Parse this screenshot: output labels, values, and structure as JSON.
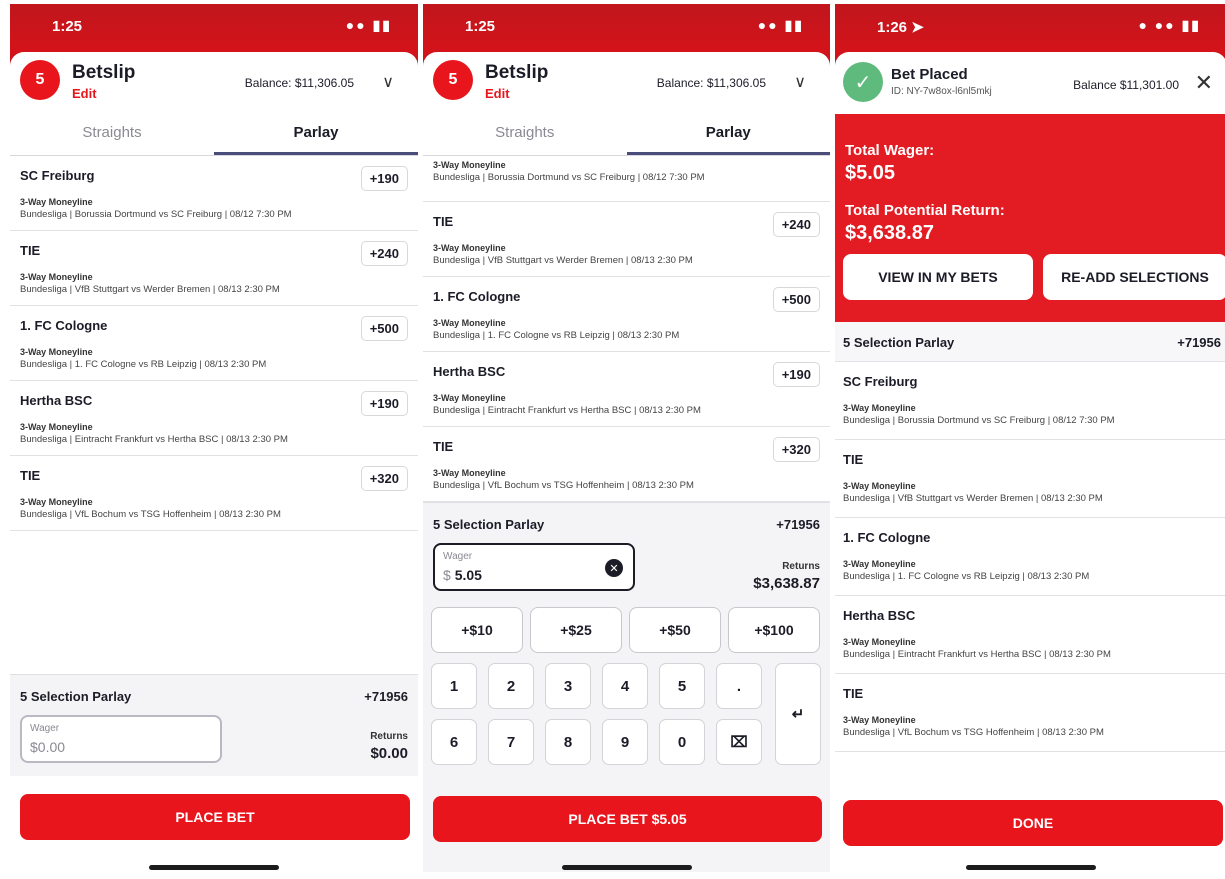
{
  "phone1": {
    "status_time": "1:25",
    "badge_count": "5",
    "title": "Betslip",
    "edit_label": "Edit",
    "balance": "Balance: $11,306.05",
    "tabs": [
      "Straights",
      "Parlay"
    ],
    "legs": [
      {
        "team": "SC Freiburg",
        "odds": "+190",
        "market": "3-Way Moneyline",
        "game": "Bundesliga | Borussia Dortmund vs SC Freiburg | 08/12 7:30 PM"
      },
      {
        "team": "TIE",
        "odds": "+240",
        "market": "3-Way Moneyline",
        "game": "Bundesliga | VfB Stuttgart vs Werder Bremen | 08/13 2:30 PM"
      },
      {
        "team": "1. FC Cologne",
        "odds": "+500",
        "market": "3-Way Moneyline",
        "game": "Bundesliga | 1. FC Cologne vs RB Leipzig | 08/13 2:30 PM"
      },
      {
        "team": "Hertha BSC",
        "odds": "+190",
        "market": "3-Way Moneyline",
        "game": "Bundesliga | Eintracht Frankfurt vs Hertha BSC | 08/13 2:30 PM"
      },
      {
        "team": "TIE",
        "odds": "+320",
        "market": "3-Way Moneyline",
        "game": "Bundesliga | VfL Bochum vs TSG Hoffenheim | 08/13 2:30 PM"
      }
    ],
    "parlay_label": "5 Selection Parlay",
    "parlay_odds": "+71956",
    "wager_label": "Wager",
    "wager_value": "$0.00",
    "returns_label": "Returns",
    "returns_value": "$0.00",
    "place_bet_label": "PLACE BET"
  },
  "phone2": {
    "status_time": "1:25",
    "badge_count": "5",
    "title": "Betslip",
    "edit_label": "Edit",
    "balance": "Balance: $11,306.05",
    "tabs": [
      "Straights",
      "Parlay"
    ],
    "top_partial": {
      "market": "3-Way Moneyline",
      "game": "Bundesliga | Borussia Dortmund vs SC Freiburg | 08/12 7:30 PM"
    },
    "legs": [
      {
        "team": "TIE",
        "odds": "+240",
        "market": "3-Way Moneyline",
        "game": "Bundesliga | VfB Stuttgart vs Werder Bremen | 08/13 2:30 PM"
      },
      {
        "team": "1. FC Cologne",
        "odds": "+500",
        "market": "3-Way Moneyline",
        "game": "Bundesliga | 1. FC Cologne vs RB Leipzig | 08/13 2:30 PM"
      },
      {
        "team": "Hertha BSC",
        "odds": "+190",
        "market": "3-Way Moneyline",
        "game": "Bundesliga | Eintracht Frankfurt vs Hertha BSC | 08/13 2:30 PM"
      },
      {
        "team": "TIE",
        "odds": "+320",
        "market": "3-Way Moneyline",
        "game": "Bundesliga | VfL Bochum vs TSG Hoffenheim | 08/13 2:30 PM"
      }
    ],
    "parlay_label": "5 Selection Parlay",
    "parlay_odds": "+71956",
    "wager_label": "Wager",
    "wager_currency": "$",
    "wager_value": "5.05",
    "returns_label": "Returns",
    "returns_value": "$3,638.87",
    "quick_amounts": [
      "+$10",
      "+$25",
      "+$50",
      "+$100"
    ],
    "keys_row1": [
      "1",
      "2",
      "3",
      "4",
      "5",
      "."
    ],
    "keys_row2": [
      "6",
      "7",
      "8",
      "9",
      "0"
    ],
    "place_bet_label": "PLACE BET $5.05"
  },
  "phone3": {
    "status_time": "1:26",
    "title": "Bet Placed",
    "bet_id": "ID: NY-7w8ox-l6nl5mkj",
    "balance": "Balance $11,301.00",
    "total_wager_label": "Total Wager:",
    "total_wager_value": "$5.05",
    "potential_return_label": "Total Potential Return:",
    "potential_return_value": "$3,638.87",
    "view_bets_label": "VIEW IN MY BETS",
    "readd_label": "RE-ADD SELECTIONS",
    "parlay_label": "5 Selection Parlay",
    "parlay_odds": "+71956",
    "legs": [
      {
        "team": "SC Freiburg",
        "market": "3-Way Moneyline",
        "game": "Bundesliga | Borussia Dortmund vs SC Freiburg | 08/12 7:30 PM"
      },
      {
        "team": "TIE",
        "market": "3-Way Moneyline",
        "game": "Bundesliga | VfB Stuttgart vs Werder Bremen | 08/13 2:30 PM"
      },
      {
        "team": "1. FC Cologne",
        "market": "3-Way Moneyline",
        "game": "Bundesliga | 1. FC Cologne vs RB Leipzig | 08/13 2:30 PM"
      },
      {
        "team": "Hertha BSC",
        "market": "3-Way Moneyline",
        "game": "Bundesliga | Eintracht Frankfurt vs Hertha BSC | 08/13 2:30 PM"
      },
      {
        "team": "TIE",
        "market": "3-Way Moneyline",
        "game": "Bundesliga | VfL Bochum vs TSG Hoffenheim | 08/13 2:30 PM"
      }
    ],
    "done_label": "DONE"
  },
  "colors": {
    "brand_red": "#e8161c",
    "success_green": "#5fba7d",
    "tab_underline": "#4a4c7a"
  }
}
